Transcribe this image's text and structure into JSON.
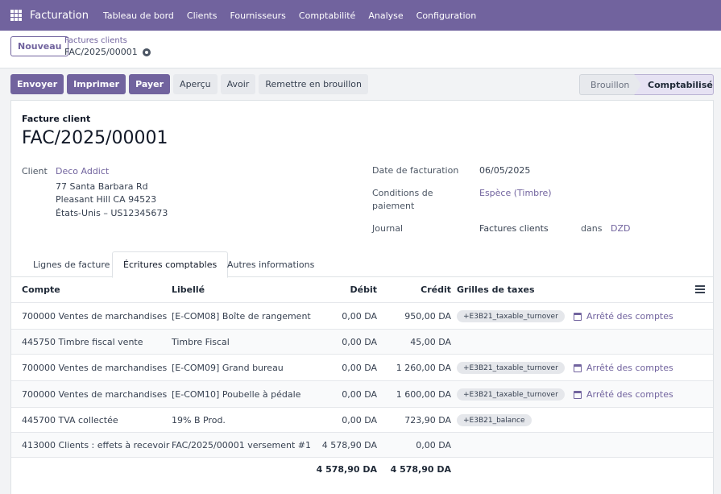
{
  "navbar": {
    "brand": "Facturation",
    "menu": [
      "Tableau de bord",
      "Clients",
      "Fournisseurs",
      "Comptabilité",
      "Analyse",
      "Configuration"
    ]
  },
  "control_panel": {
    "new_label": "Nouveau",
    "breadcrumb_parent": "Factures clients",
    "breadcrumb_current": "FAC/2025/00001"
  },
  "actions": {
    "send": "Envoyer",
    "print": "Imprimer",
    "pay": "Payer",
    "preview": "Aperçu",
    "credit_note": "Avoir",
    "reset_draft": "Remettre en brouillon"
  },
  "status": {
    "draft": "Brouillon",
    "posted": "Comptabilisé"
  },
  "invoice": {
    "type": "Facture client",
    "name": "FAC/2025/00001",
    "customer_label": "Client",
    "customer_name": "Deco Addict",
    "address_line1": "77 Santa Barbara Rd",
    "address_line2": "Pleasant Hill CA 94523",
    "address_line3": "États-Unis – US12345673",
    "date_label": "Date de facturation",
    "date_value": "06/05/2025",
    "terms_label_1": "Conditions de",
    "terms_label_2": "paiement",
    "terms_value": "Espèce (Timbre)",
    "journal_label": "Journal",
    "journal_value": "Factures clients",
    "journal_in": "dans",
    "currency": "DZD"
  },
  "tabs": [
    "Lignes de facture",
    "Écritures comptables",
    "Autres informations"
  ],
  "table": {
    "headers": {
      "account": "Compte",
      "label": "Libellé",
      "debit": "Débit",
      "credit": "Crédit",
      "tax_grids": "Grilles de taxes"
    },
    "rows": [
      {
        "account": "700000 Ventes de marchandises",
        "label": "[E-COM08] Boîte de rangement",
        "debit": "0,00 DA",
        "credit": "950,00 DA",
        "tag": "+E3B21_taxable_turnover",
        "analytic": "Arrêté des comptes"
      },
      {
        "account": "445750 Timbre fiscal vente",
        "label": "Timbre Fiscal",
        "debit": "0,00 DA",
        "credit": "45,00 DA",
        "tag": "",
        "analytic": ""
      },
      {
        "account": "700000 Ventes de marchandises",
        "label": "[E-COM09] Grand bureau",
        "debit": "0,00 DA",
        "credit": "1 260,00 DA",
        "tag": "+E3B21_taxable_turnover",
        "analytic": "Arrêté des comptes"
      },
      {
        "account": "700000 Ventes de marchandises",
        "label": "[E-COM10] Poubelle à pédale",
        "debit": "0,00 DA",
        "credit": "1 600,00 DA",
        "tag": "+E3B21_taxable_turnover",
        "analytic": "Arrêté des comptes"
      },
      {
        "account": "445700 TVA collectée",
        "label": "19% B Prod.",
        "debit": "0,00 DA",
        "credit": "723,90 DA",
        "tag": "+E3B21_balance",
        "analytic": ""
      },
      {
        "account": "413000 Clients : effets à recevoir",
        "label": "FAC/2025/00001 versement #1",
        "debit": "4 578,90 DA",
        "credit": "0,00 DA",
        "tag": "",
        "analytic": ""
      }
    ],
    "total_debit": "4 578,90 DA",
    "total_credit": "4 578,90 DA"
  }
}
